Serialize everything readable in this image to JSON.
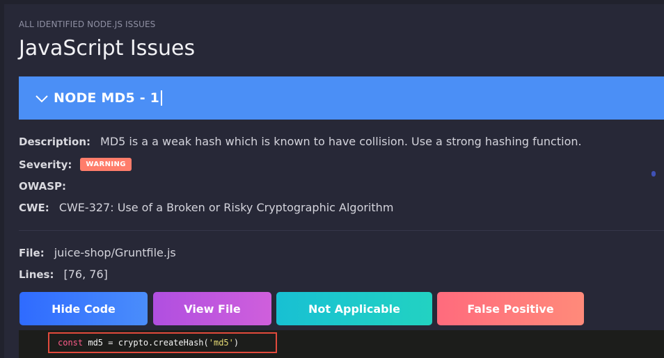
{
  "header": {
    "subtitle": "ALL IDENTIFIED NODE.JS ISSUES",
    "title": "JavaScript Issues"
  },
  "accordion": {
    "label": "NODE MD5 - 1",
    "icon": "chevron-down-icon"
  },
  "details": {
    "description_key": "Description:",
    "description_value": "MD5 is a a weak hash which is known to have collision. Use a strong hashing function.",
    "severity_key": "Severity:",
    "severity_badge": "WARNING",
    "owasp_key": "OWASP:",
    "cwe_key": "CWE:",
    "cwe_value": "CWE-327: Use of a Broken or Risky Cryptographic Algorithm"
  },
  "file": {
    "file_key": "File:",
    "file_value": "juice-shop/Gruntfile.js",
    "lines_key": "Lines:",
    "lines_value": "[76, 76]"
  },
  "actions": {
    "hide_code": "Hide Code",
    "view_file": "View File",
    "not_applicable": "Not Applicable",
    "false_positive": "False Positive"
  },
  "code": {
    "keyword": "const",
    "rest_before_string": " md5 = crypto.createHash(",
    "string": "'md5'",
    "rest_after_string": ")"
  },
  "colors": {
    "accordion": "#4b8ff6",
    "badge": "#ff7d6b",
    "highlight_border": "#e24a3c"
  }
}
